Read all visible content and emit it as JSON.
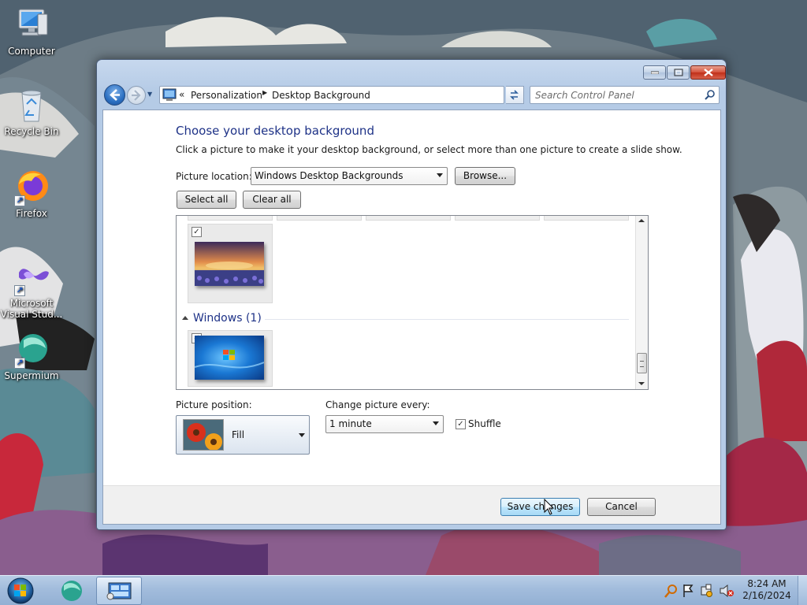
{
  "desktop": {
    "icons": [
      {
        "label": "Computer"
      },
      {
        "label": "Recycle Bin"
      },
      {
        "label": "Firefox"
      },
      {
        "label": "Microsoft Visual Stud..."
      },
      {
        "label": "Supermium"
      }
    ]
  },
  "window": {
    "breadcrumb": [
      "Personalization",
      "Desktop Background"
    ],
    "breadcrumb_overflow": "«",
    "search_placeholder": "Search Control Panel",
    "page_title": "Choose your desktop background",
    "page_subtitle": "Click a picture to make it your desktop background, or select more than one picture to create a slide show.",
    "picture_location_label": "Picture location:",
    "picture_location_value": "Windows Desktop Backgrounds",
    "browse_label": "Browse...",
    "select_all_label": "Select all",
    "clear_all_label": "Clear all",
    "picture_groups": [
      {
        "name": "",
        "thumbnails": [
          {
            "checked": true,
            "subject": "sunset lake with flowers"
          }
        ]
      },
      {
        "name": "Windows (1)",
        "thumbnails": [
          {
            "checked": true,
            "subject": "windows logo blue"
          }
        ]
      }
    ],
    "picture_position_label": "Picture position:",
    "picture_position_value": "Fill",
    "change_every_label": "Change picture every:",
    "change_every_value": "1 minute",
    "shuffle_label": "Shuffle",
    "shuffle_checked": true,
    "save_label": "Save changes",
    "cancel_label": "Cancel"
  },
  "taskbar": {
    "time": "8:24 AM",
    "date": "2/16/2024",
    "tray_icons": [
      "search-icon",
      "flag-icon",
      "network-icon",
      "volume-muted-icon"
    ]
  },
  "colors": {
    "title_blue": "#1e3287",
    "accent_button": "#bee6fd",
    "taskbar": "#a2bcdc"
  }
}
